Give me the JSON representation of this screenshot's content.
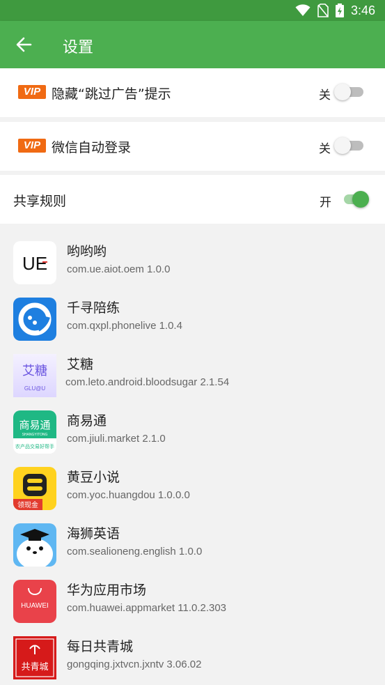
{
  "status_bar": {
    "time": "3:46",
    "icons": [
      "wifi-icon",
      "no-sim-icon",
      "battery-charging-icon"
    ]
  },
  "app_bar": {
    "title": "设置",
    "back_icon": "arrow-back-icon"
  },
  "settings": [
    {
      "badge": "VIP",
      "label": "隐藏“跳过广告”提示",
      "state": "关",
      "on": false
    },
    {
      "badge": "VIP",
      "label": "微信自动登录",
      "state": "关",
      "on": false
    },
    {
      "label": "共享规则",
      "state": "开",
      "on": true
    }
  ],
  "apps": [
    {
      "name": "哟哟哟",
      "package": "com.ue.aiot.oem 1.0.0",
      "icon_text": "UE"
    },
    {
      "name": "千寻陪练",
      "package": "com.qxpl.phonelive 1.0.4"
    },
    {
      "name": "艾糖",
      "package": "com.leto.android.bloodsugar 2.1.54",
      "icon_text": "艾糖",
      "icon_subtext": "GLU@U"
    },
    {
      "name": "商易通",
      "package": "com.jiuli.market 2.1.0",
      "icon_text": "商易通",
      "icon_subtext": "SHANGYITONG",
      "icon_caption": "农产品交易好帮手"
    },
    {
      "name": "黄豆小说",
      "package": "com.yoc.huangdou 1.0.0.0",
      "icon_caption": "领现金"
    },
    {
      "name": "海狮英语",
      "package": "com.sealioneng.english 1.0.0"
    },
    {
      "name": "华为应用市场",
      "package": "com.huawei.appmarket 11.0.2.303",
      "icon_text": "HUAWEI"
    },
    {
      "name": "每日共青城",
      "package": "gongqing.jxtvcn.jxntv 3.06.02",
      "icon_text": "共青城"
    }
  ],
  "colors": {
    "status_bar": "#3f9a3f",
    "app_bar": "#4caf50",
    "vip_badge": "#f06a13",
    "switch_on": "#4caf50"
  }
}
